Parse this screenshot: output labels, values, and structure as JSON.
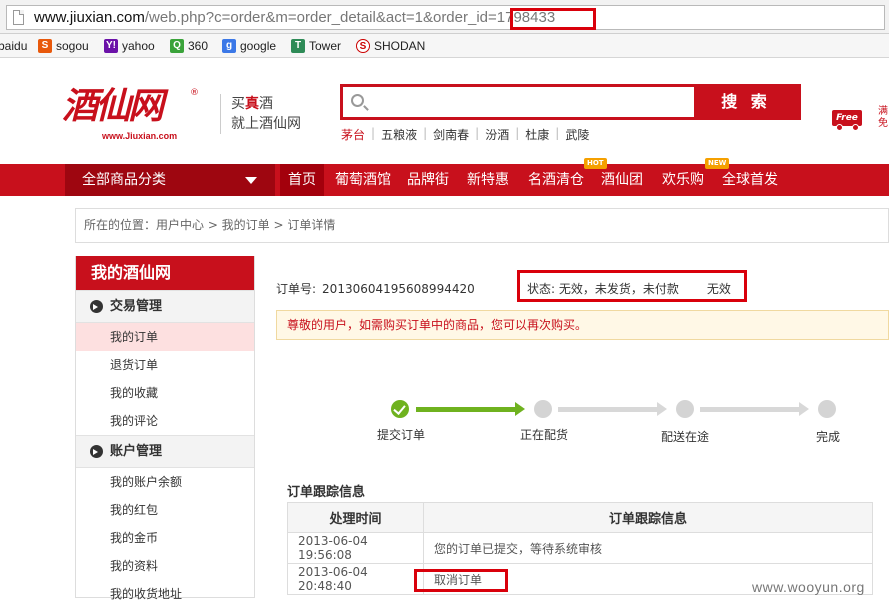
{
  "browser": {
    "url_host": "www.jiuxian.com",
    "url_path": "/web.php?c=order&m=order_detail&act=1&order_id=",
    "url_highlight": "1798433",
    "bookmarks": [
      "baidu",
      "sogou",
      "yahoo",
      "360",
      "google",
      "Tower",
      "SHODAN"
    ]
  },
  "header": {
    "logo_text": "酒仙网",
    "logo_url": "www.Jiuxian.com",
    "slogan_line1_a": "买",
    "slogan_line1_b": "真",
    "slogan_line1_c": "酒",
    "slogan_line2": "就上酒仙网",
    "search_placeholder": "",
    "search_button": "搜 索",
    "hot_keywords": [
      "茅台",
      "五粮液",
      "剑南春",
      "汾酒",
      "杜康",
      "武陵"
    ],
    "free_badge": "Free",
    "free_text_1": "满",
    "free_text_2": "免"
  },
  "nav": {
    "all_categories": "全部商品分类",
    "items": [
      "首页",
      "葡萄酒馆",
      "品牌街",
      "新特惠",
      "名酒清仓",
      "酒仙团",
      "欢乐购",
      "全球首发"
    ],
    "badge_hot": "HOT",
    "badge_new": "NEW"
  },
  "breadcrumb": "所在的位置：用户中心 > 我的订单 > 订单详情",
  "sidebar": {
    "title": "我的酒仙网",
    "sections": [
      {
        "label": "交易管理",
        "items": [
          "我的订单",
          "退货订单",
          "我的收藏",
          "我的评论"
        ]
      },
      {
        "label": "账户管理",
        "items": [
          "我的账户余额",
          "我的红包",
          "我的金币",
          "我的资料",
          "我的收货地址"
        ]
      }
    ]
  },
  "order": {
    "number_label": "订单号:",
    "number": "20130604195608994420",
    "status_label": "状态: 无效，未发货，未付款",
    "status_value": "无效",
    "notice": "尊敬的用户，如需购买订单中的商品，您可以再次购买。"
  },
  "progress": {
    "steps": [
      "提交订单",
      "正在配货",
      "配送在途",
      "完成"
    ],
    "completed_steps": 1
  },
  "tracking": {
    "title": "订单跟踪信息",
    "headers": [
      "处理时间",
      "订单跟踪信息"
    ],
    "rows": [
      {
        "time": "2013-06-04 19:56:08",
        "info": "您的订单已提交，等待系统审核"
      },
      {
        "time": "2013-06-04 20:48:40",
        "info": "取消订单"
      }
    ]
  },
  "watermark": "www.wooyun.org",
  "colors": {
    "brand_red": "#c8101c",
    "highlight_box": "#d9000b",
    "progress_green": "#6fb21f"
  }
}
